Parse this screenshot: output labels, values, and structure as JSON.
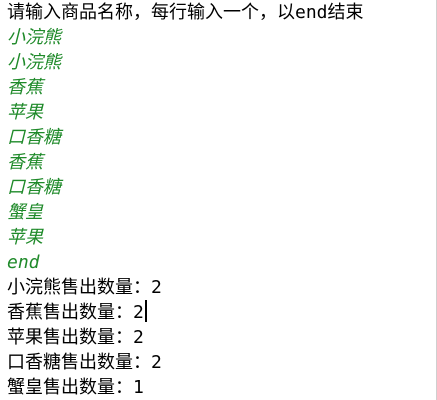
{
  "console": {
    "prompt": "请输入商品名称，每行输入一个，以end结束",
    "inputs": [
      "小浣熊",
      "小浣熊",
      "香蕉",
      "苹果",
      "口香糖",
      "香蕉",
      "口香糖",
      "蟹皇",
      "苹果",
      "end"
    ],
    "outputs": [
      "小浣熊售出数量：2",
      "香蕉售出数量：2",
      "苹果售出数量：2",
      "口香糖售出数量：2",
      "蟹皇售出数量：1"
    ]
  },
  "colors": {
    "input_text": "#1f8a2a",
    "output_text": "#000000",
    "background": "#ffffff"
  }
}
